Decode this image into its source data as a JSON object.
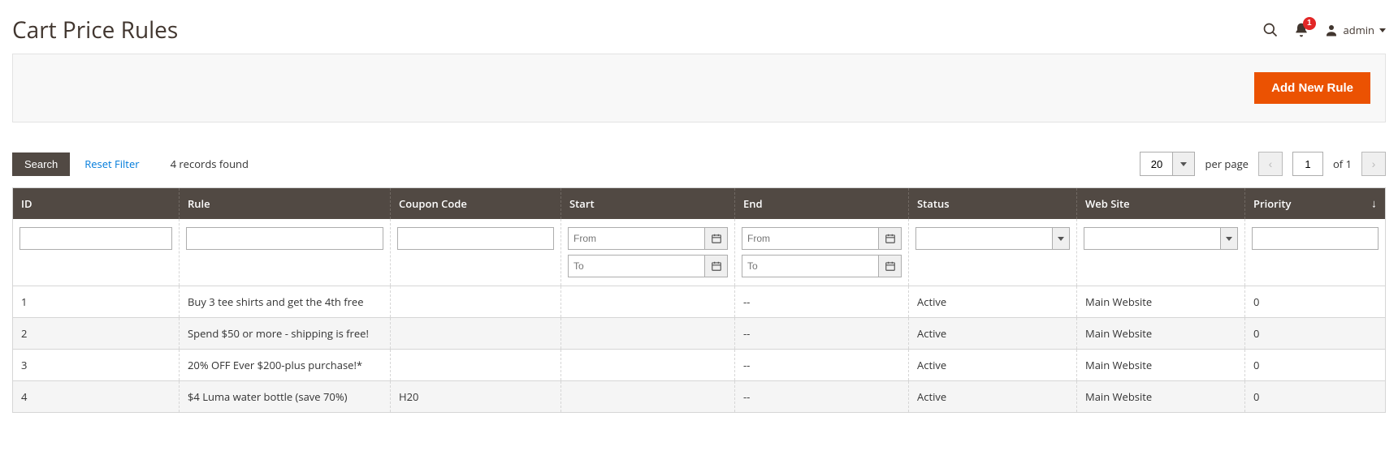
{
  "header": {
    "title": "Cart Price Rules",
    "notif_count": "1",
    "username": "admin"
  },
  "actions": {
    "add_new_rule": "Add New Rule"
  },
  "toolbar": {
    "search_label": "Search",
    "reset_filter_label": "Reset Filter",
    "records_found": "4 records found",
    "page_size": "20",
    "per_page_label": "per page",
    "current_page": "1",
    "of_label": "of",
    "total_pages": "1"
  },
  "columns": {
    "id": "ID",
    "rule": "Rule",
    "coupon": "Coupon Code",
    "start": "Start",
    "end": "End",
    "status": "Status",
    "website": "Web Site",
    "priority": "Priority"
  },
  "filters": {
    "date_from_placeholder": "From",
    "date_to_placeholder": "To"
  },
  "rows": [
    {
      "id": "1",
      "rule": "Buy 3 tee shirts and get the 4th free",
      "coupon": "",
      "start": "",
      "end": "--",
      "status": "Active",
      "website": "Main Website",
      "priority": "0"
    },
    {
      "id": "2",
      "rule": "Spend $50 or more - shipping is free!",
      "coupon": "",
      "start": "",
      "end": "--",
      "status": "Active",
      "website": "Main Website",
      "priority": "0"
    },
    {
      "id": "3",
      "rule": "20% OFF Ever $200-plus purchase!*",
      "coupon": "",
      "start": "",
      "end": "--",
      "status": "Active",
      "website": "Main Website",
      "priority": "0"
    },
    {
      "id": "4",
      "rule": "$4 Luma water bottle (save 70%)",
      "coupon": "H20",
      "start": "",
      "end": "--",
      "status": "Active",
      "website": "Main Website",
      "priority": "0"
    }
  ]
}
